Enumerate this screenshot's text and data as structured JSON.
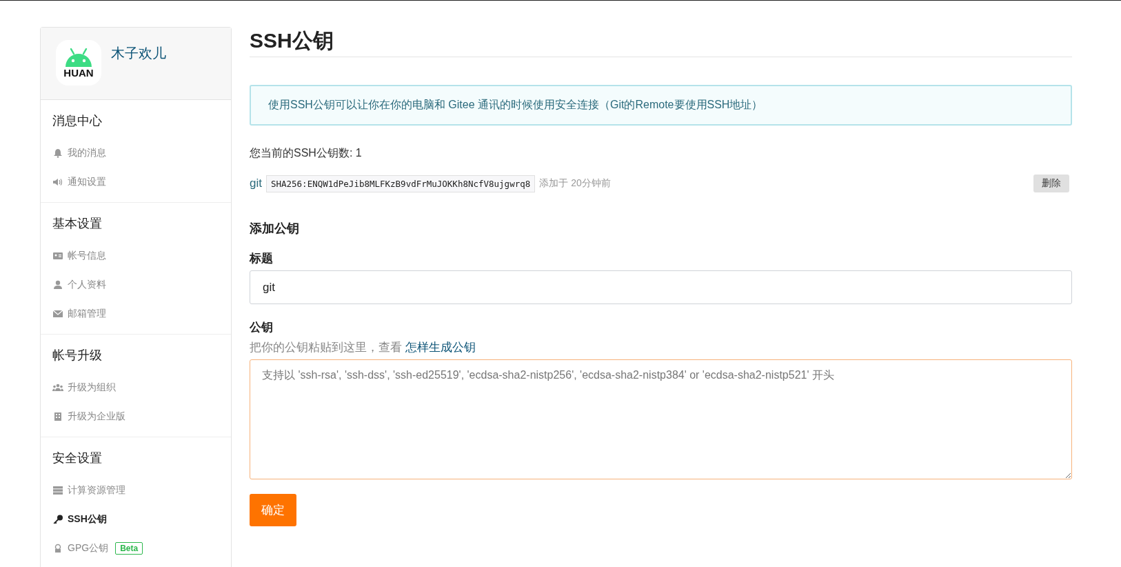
{
  "profile": {
    "name": "木子欢儿",
    "avatar_text": "HUAN"
  },
  "sidebar": {
    "groups": [
      {
        "title": "消息中心",
        "items": [
          {
            "label": "我的消息",
            "kind": "bell",
            "selected": false
          },
          {
            "label": "通知设置",
            "kind": "speaker",
            "selected": false
          }
        ]
      },
      {
        "title": "基本设置",
        "items": [
          {
            "label": "帐号信息",
            "kind": "card",
            "selected": false
          },
          {
            "label": "个人资料",
            "kind": "user",
            "selected": false
          },
          {
            "label": "邮箱管理",
            "kind": "mail",
            "selected": false
          }
        ]
      },
      {
        "title": "帐号升级",
        "items": [
          {
            "label": "升级为组织",
            "kind": "users",
            "selected": false
          },
          {
            "label": "升级为企业版",
            "kind": "building",
            "selected": false
          }
        ]
      },
      {
        "title": "安全设置",
        "items": [
          {
            "label": "计算资源管理",
            "kind": "server",
            "selected": false
          },
          {
            "label": "SSH公钥",
            "kind": "key",
            "selected": true
          },
          {
            "label": "GPG公钥",
            "kind": "lock",
            "selected": false,
            "badge": "Beta"
          }
        ]
      }
    ]
  },
  "page": {
    "title": "SSH公钥",
    "info": "使用SSH公钥可以让你在你的电脑和 Gitee 通讯的时候使用安全连接（Git的Remote要使用SSH地址）",
    "count": "您当前的SSH公钥数: 1",
    "keys": [
      {
        "name": "git",
        "fingerprint": "SHA256:ENQW1dPeJib8MLFKzB9vdFrMuJOKKh8NcfV8ujgwrq8",
        "added": "添加于 20分钟前",
        "delete": "删除"
      }
    ],
    "add_title": "添加公钥",
    "title_label": "标题",
    "title_value": "git",
    "key_label": "公钥",
    "key_help": "把你的公钥粘贴到这里，查看",
    "key_help_link": "怎样生成公钥",
    "key_placeholder": "支持以 'ssh-rsa', 'ssh-dss', 'ssh-ed25519', 'ecdsa-sha2-nistp256', 'ecdsa-sha2-nistp384' or 'ecdsa-sha2-nistp521' 开头",
    "submit": "确定"
  }
}
